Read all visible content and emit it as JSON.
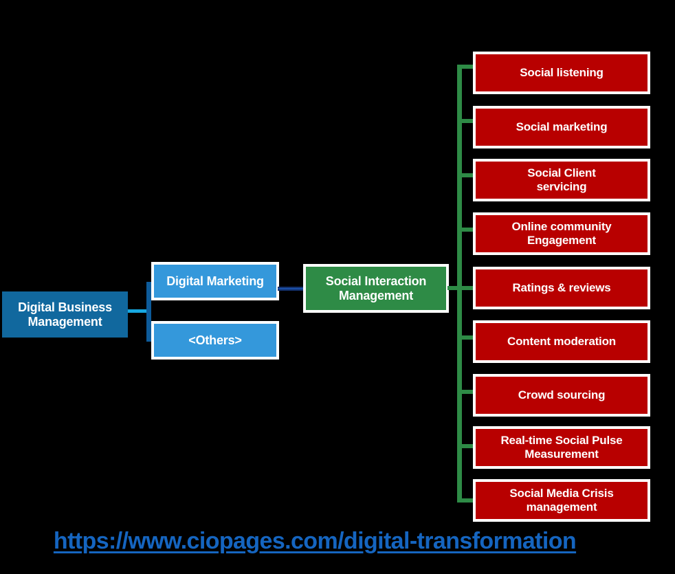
{
  "diagram": {
    "type": "hierarchy-tree",
    "background_color": "#000000",
    "root": {
      "label": "Digital Business\nManagement",
      "line1": "Digital Business",
      "line2": "Management",
      "color": "#11689E"
    },
    "level2": [
      {
        "label": "Digital Marketing",
        "color": "#3498DB"
      },
      {
        "label": "<Others>",
        "color": "#3498DB"
      }
    ],
    "level3": {
      "line1": "Social Interaction",
      "line2": "Management",
      "label": "Social Interaction Management",
      "color": "#2E8B46"
    },
    "leaves": [
      {
        "line1": "Social listening",
        "line2": ""
      },
      {
        "line1": "Social marketing",
        "line2": ""
      },
      {
        "line1": "Social Client",
        "line2": "servicing"
      },
      {
        "line1": "Online community",
        "line2": "Engagement"
      },
      {
        "line1": "Ratings & reviews",
        "line2": ""
      },
      {
        "line1": "Content moderation",
        "line2": ""
      },
      {
        "line1": "Crowd sourcing",
        "line2": ""
      },
      {
        "line1": "Real-time Social Pulse",
        "line2": "Measurement"
      },
      {
        "line1": "Social Media Crisis",
        "line2": "management"
      }
    ],
    "leaf_color": "#B80000",
    "connector_colors": {
      "root_bracket": "#0D5B9A",
      "blue_to_green": "#12306B",
      "green_spine": "#2E8B46",
      "accent": "#17A8E0"
    }
  },
  "footer": {
    "url": "https://www.ciopages.com/digital-transformation",
    "color": "#1565C0"
  }
}
